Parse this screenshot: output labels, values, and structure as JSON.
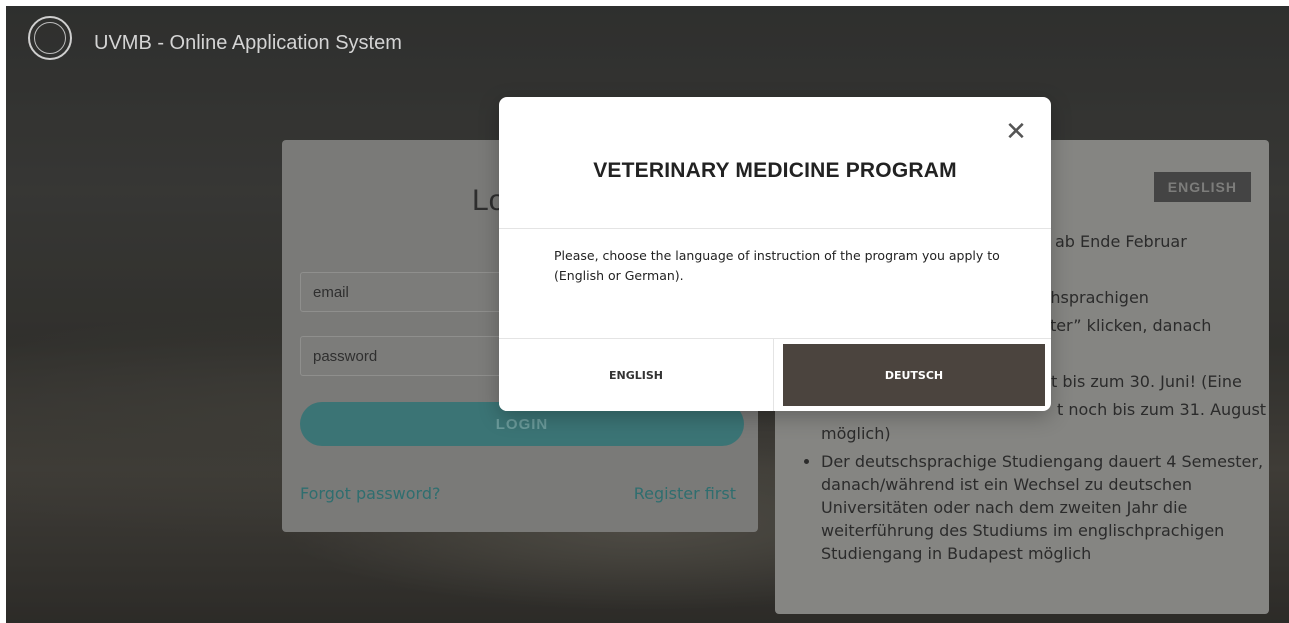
{
  "header": {
    "app_title": "UVMB - Online Application System",
    "logo_icon": "university-seal-icon"
  },
  "login": {
    "title": "Lo",
    "email_placeholder": "email",
    "password_placeholder": "password",
    "login_label": "LOGIN",
    "forgot_label": "Forgot password?",
    "register_label": "Register first"
  },
  "info": {
    "badge": "ENGLISH",
    "line1": "ab Ende Februar",
    "line2": "tschsprachigen",
    "line3": "gister” klicken, danach",
    "line4": "t bis zum 30. Juni! (Eine",
    "line5": "t noch bis zum 31. August",
    "line6": "möglich)",
    "list_item": "Der deutschsprachige Studiengang dauert 4 Semester, danach/während ist ein Wechsel zu deutschen Universitäten oder nach dem zweiten Jahr die weiterführung des Studiums im englischprachigen Studiengang in Budapest möglich"
  },
  "modal": {
    "title": "VETERINARY MEDICINE PROGRAM",
    "body": "Please, choose the language of instruction of the program you apply to (English or German).",
    "close_icon": "close-icon",
    "english_label": "ENGLISH",
    "deutsch_label": "DEUTSCH"
  },
  "colors": {
    "accent_teal": "#3b7475",
    "deutsch_button": "#4b443e"
  }
}
